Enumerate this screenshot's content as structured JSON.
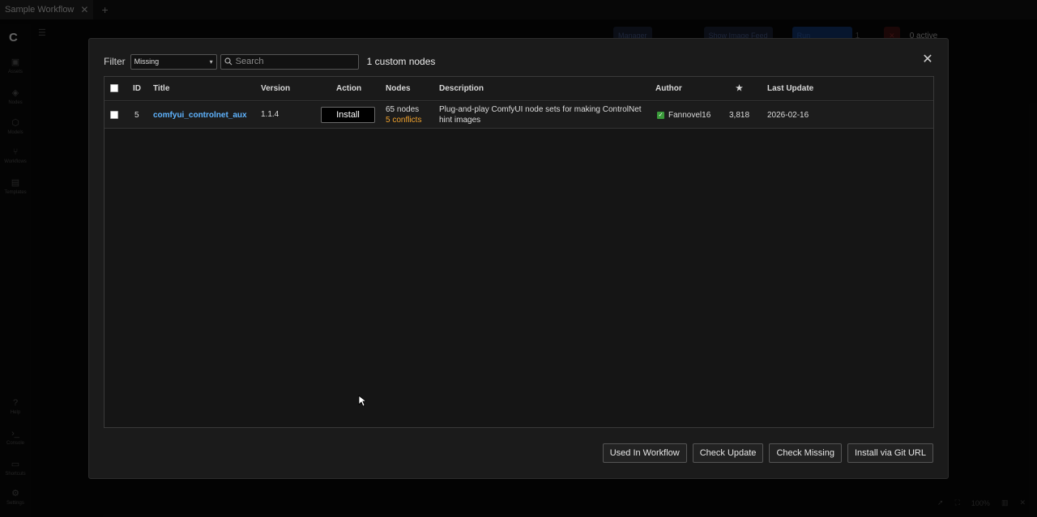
{
  "window": {
    "tab_title": "Sample Workflow",
    "tab_close_icon": "close-icon",
    "tab_add_icon": "plus-icon"
  },
  "sidebar": {
    "items": [
      {
        "label": "Assets",
        "icon": "image-icon"
      },
      {
        "label": "Nodes",
        "icon": "node-icon"
      },
      {
        "label": "Models",
        "icon": "cube-icon"
      },
      {
        "label": "Workflows",
        "icon": "workflow-icon"
      },
      {
        "label": "Templates",
        "icon": "template-icon"
      }
    ],
    "bottom_items": [
      {
        "label": "Help",
        "icon": "help-icon"
      },
      {
        "label": "Console",
        "icon": "terminal-icon"
      },
      {
        "label": "Shortcuts",
        "icon": "keyboard-icon"
      },
      {
        "label": "Settings",
        "icon": "gear-icon"
      }
    ]
  },
  "topbar": {
    "manager_label": "Manager",
    "image_feed_label": "Show Image Feed",
    "run_label": "Run",
    "queue_count": "1",
    "active_label": "0 active"
  },
  "bottom_tools": {
    "zoom": "100%"
  },
  "modal": {
    "filter_label": "Filter",
    "filter_value": "Missing",
    "search_placeholder": "Search",
    "count_label": "1 custom nodes",
    "columns": {
      "id": "ID",
      "title": "Title",
      "version": "Version",
      "action": "Action",
      "nodes": "Nodes",
      "description": "Description",
      "author": "Author",
      "stars": "★",
      "last_update": "Last Update"
    },
    "rows": [
      {
        "id": "5",
        "title": "comfyui_controlnet_aux",
        "version": "1.1.4",
        "action": "Install",
        "nodes_count": "65 nodes",
        "conflicts": "5 conflicts",
        "description_line1": "Plug-and-play ComfyUI node sets for making ControlNet",
        "description_line2": "hint images",
        "author": "Fannovel16",
        "stars": "3,818",
        "last_update": "2026-02-16"
      }
    ],
    "footer_buttons": {
      "used_in_workflow": "Used In Workflow",
      "check_update": "Check Update",
      "check_missing": "Check Missing",
      "install_git": "Install via Git URL"
    }
  },
  "colors": {
    "accent_link": "#5fb4ff",
    "conflict": "#f0a22d",
    "verified": "#3a9a3a"
  }
}
